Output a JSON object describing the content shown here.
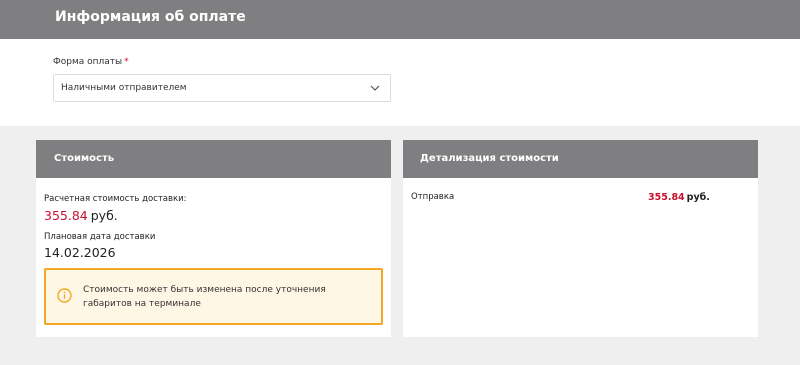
{
  "header": {
    "title": "Информация об оплате"
  },
  "payment_form": {
    "label": "Форма оплаты",
    "required_mark": "*",
    "selected_value": "Наличными отправителем"
  },
  "cost_card": {
    "title": "Стоимость",
    "estimated_label": "Расчетная стоимость доставки:",
    "estimated_value": "355.84",
    "currency": "руб.",
    "planned_date_label": "Плановая дата доставки",
    "planned_date_value": "14.02.2026",
    "notice_text": "Стоимость может быть изменена после уточнения габаритов на терминале"
  },
  "detail_card": {
    "title": "Детализация стоимости",
    "rows": [
      {
        "label": "Отправка",
        "value": "355.84",
        "currency": "руб."
      }
    ]
  },
  "colors": {
    "header_bg": "#7f7f81",
    "accent_price": "#c8102e",
    "notice_border": "#f5a623",
    "notice_bg": "#fff7e6"
  }
}
